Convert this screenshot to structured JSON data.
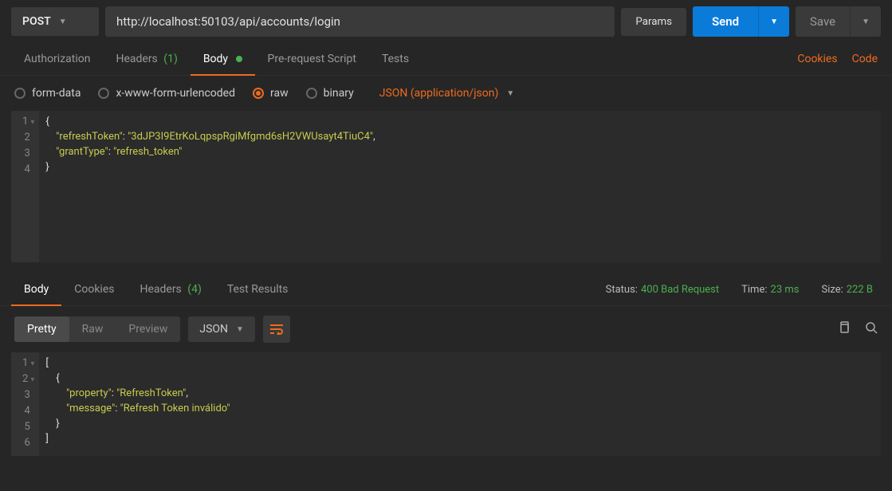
{
  "request": {
    "method": "POST",
    "url": "http://localhost:50103/api/accounts/login",
    "params_btn": "Params",
    "send_btn": "Send",
    "save_btn": "Save"
  },
  "req_tabs": {
    "auth": "Authorization",
    "headers": "Headers",
    "headers_count": "(1)",
    "body": "Body",
    "prs": "Pre-request Script",
    "tests": "Tests",
    "cookies": "Cookies",
    "code": "Code"
  },
  "body_opts": {
    "formdata": "form-data",
    "urlencoded": "x-www-form-urlencoded",
    "raw": "raw",
    "binary": "binary",
    "content_type": "JSON (application/json)"
  },
  "req_body_lines": [
    {
      "n": "1",
      "fold": "▾",
      "html": "<span class='pun'>{</span>"
    },
    {
      "n": "2",
      "fold": "",
      "html": "    <span class='key'>\"refreshToken\"</span><span class='pun'>: </span><span class='str'>\"3dJP3I9EtrKoLqpspRgiMfgmd6sH2VWUsayt4TiuC4\"</span><span class='pun'>,</span>"
    },
    {
      "n": "3",
      "fold": "",
      "html": "    <span class='key'>\"grantType\"</span><span class='pun'>: </span><span class='str'>\"refresh_token\"</span>"
    },
    {
      "n": "4",
      "fold": "",
      "html": "<span class='pun'>}</span>"
    }
  ],
  "resp_tabs": {
    "body": "Body",
    "cookies": "Cookies",
    "headers": "Headers",
    "headers_count": "(4)",
    "tests": "Test Results"
  },
  "resp_status": {
    "status_label": "Status:",
    "status_val": "400 Bad Request",
    "time_label": "Time:",
    "time_val": "23 ms",
    "size_label": "Size:",
    "size_val": "222 B"
  },
  "resp_view": {
    "pretty": "Pretty",
    "raw": "Raw",
    "preview": "Preview",
    "format": "JSON"
  },
  "resp_body_lines": [
    {
      "n": "1",
      "fold": "▾",
      "html": "<span class='pun'>[</span>"
    },
    {
      "n": "2",
      "fold": "▾",
      "html": "    <span class='pun'>{</span>"
    },
    {
      "n": "3",
      "fold": "",
      "html": "        <span class='key'>\"property\"</span><span class='pun'>: </span><span class='str'>\"RefreshToken\"</span><span class='pun'>,</span>"
    },
    {
      "n": "4",
      "fold": "",
      "html": "        <span class='key'>\"message\"</span><span class='pun'>: </span><span class='str'>\"Refresh Token inválido\"</span>"
    },
    {
      "n": "5",
      "fold": "",
      "html": "    <span class='pun'>}</span>"
    },
    {
      "n": "6",
      "fold": "",
      "html": "<span class='pun'>]</span>"
    }
  ]
}
